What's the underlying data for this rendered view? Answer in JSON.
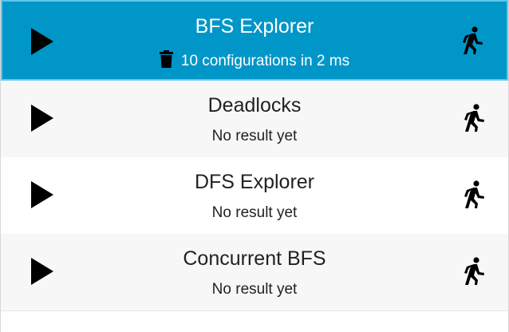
{
  "explorers": [
    {
      "title": "BFS Explorer",
      "result": "10 configurations in 2 ms",
      "selected": true,
      "icons": [
        "play-icon",
        "trash-icon",
        "runner-icon"
      ]
    },
    {
      "title": "Deadlocks",
      "result": "No result yet",
      "selected": false,
      "icons": [
        "play-icon",
        "runner-icon"
      ]
    },
    {
      "title": "DFS Explorer",
      "result": "No result yet",
      "selected": false,
      "icons": [
        "play-icon",
        "runner-icon"
      ]
    },
    {
      "title": "Concurrent BFS",
      "result": "No result yet",
      "selected": false,
      "icons": [
        "play-icon",
        "runner-icon"
      ]
    }
  ],
  "colors": {
    "selected_background": "#0096c8",
    "selected_border": "#5ec7ec",
    "row_alt_background": "#f7f7f7",
    "row_background": "#ffffff",
    "text": "#222222",
    "selected_text": "#ffffff"
  }
}
